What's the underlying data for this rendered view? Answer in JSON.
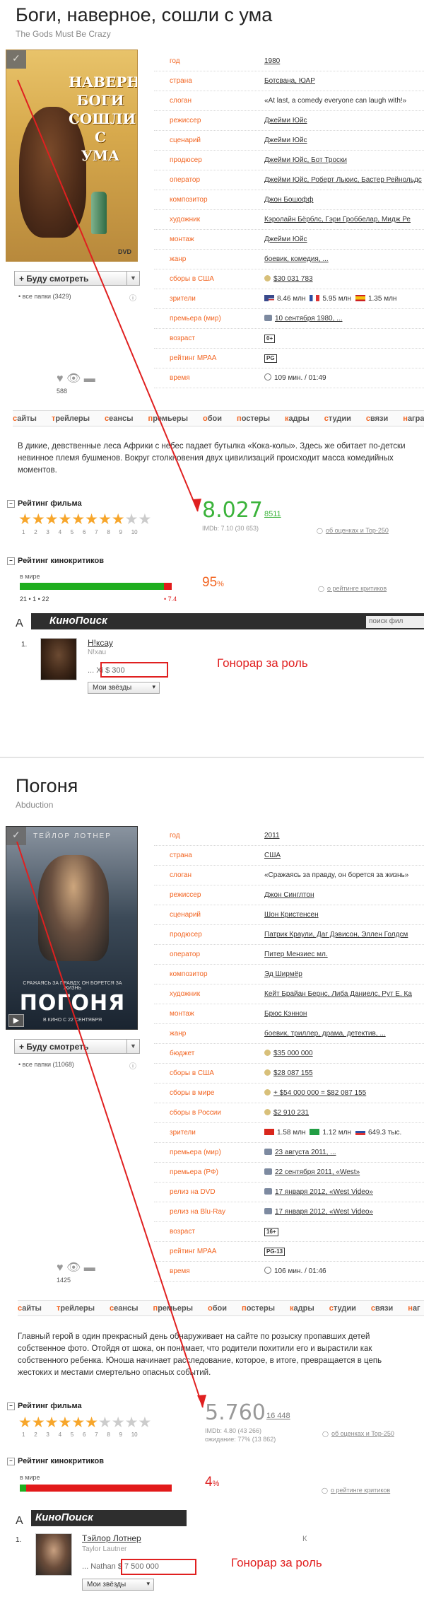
{
  "panel1": {
    "title": "Боги, наверное, сошли с ума",
    "orig_title": "The Gods Must Be Crazy",
    "poster_text": "НАВЕРНОЕ\nБОГИ\nСОШЛИ\nС\nУМА",
    "poster_dvd": "DVD",
    "will_watch": "Буду смотреть",
    "all_folders": "• все папки (3429)",
    "likes_count": "588",
    "info": [
      {
        "key": "год",
        "val": "1980",
        "link": true
      },
      {
        "key": "страна",
        "val": "Ботсвана, ЮАР",
        "link": true
      },
      {
        "key": "слоган",
        "val": "«At last, a comedy everyone can laugh with!»",
        "link": false
      },
      {
        "key": "режиссер",
        "val": "Джейми Юйс",
        "link": true
      },
      {
        "key": "сценарий",
        "val": "Джейми Юйс",
        "link": true
      },
      {
        "key": "продюсер",
        "val": "Джейми Юйс, Бот Троски",
        "link": true
      },
      {
        "key": "оператор",
        "val": "Джейми Юйс, Роберт Льюис, Бастер Рейнольдс",
        "link": true
      },
      {
        "key": "композитор",
        "val": "Джон Бошофф",
        "link": true
      },
      {
        "key": "художник",
        "val": "Кэролайн Бёрблс, Гэри Гроббелар, Мидж Ре",
        "link": true
      },
      {
        "key": "монтаж",
        "val": "Джейми Юйс",
        "link": true
      },
      {
        "key": "жанр",
        "val": "боевик, комедия, ...",
        "link": true
      },
      {
        "key": "сборы в США",
        "val": "$30 031 783",
        "link": true,
        "icon": "coin"
      },
      {
        "key": "зрители",
        "val": "",
        "link": false
      },
      {
        "key": "премьера (мир)",
        "val": "10 сентября 1980, ...",
        "link": true,
        "icon": "cal"
      },
      {
        "key": "возраст",
        "val": "0+",
        "link": false,
        "badge": true
      },
      {
        "key": "рейтинг MPAA",
        "val": "PG",
        "link": false,
        "badge": true
      },
      {
        "key": "время",
        "val": "109 мин. / 01:49",
        "link": false,
        "icon": "clock"
      }
    ],
    "viewers": [
      {
        "flag": "us",
        "val": "8.46 млн"
      },
      {
        "flag": "fr",
        "val": "5.95 млн"
      },
      {
        "flag": "es",
        "val": "1.35 млн"
      }
    ],
    "tabs": [
      "сайты",
      "трейлеры",
      "сеансы",
      "премьеры",
      "обои",
      "постеры",
      "кадры",
      "студии",
      "связи",
      "награды"
    ],
    "description": "В дикие, девственные леса Африки с небес падает бутылка «Кока-колы». Здесь же обитает по-детски невинное племя бушменов. Вокруг столкновения двух цивилизаций происходит масса комедийных моментов.",
    "rating_head": "Рейтинг фильма",
    "stars_on": 8,
    "stars_total": 10,
    "star_numbers": [
      "1",
      "2",
      "3",
      "4",
      "5",
      "6",
      "7",
      "8",
      "9",
      "10"
    ],
    "rating": "8.027",
    "votes": "8511",
    "imdb": "IMDb: 7.10 (30 653)",
    "about_link": "об оценках и Top-250",
    "critics_head": "Рейтинг кинокритиков",
    "critics_world": "в мире",
    "critics_counts": "21 • 1 • 22",
    "critics_score": "• 7.4",
    "critics_pct": "95",
    "critics_pct_sign": "%",
    "critics_fraction": 0.95,
    "critics_link": "о рейтинге критиков",
    "kp_logo": "КиноПоиск",
    "kp_search": "поиск фил",
    "kp_left": "А",
    "actor_num": "1.",
    "actor_name": "Н!ксау",
    "actor_orig": "N!xau",
    "actor_role": "... Xi",
    "fee": "$ 300",
    "my_stars": "Мои звёзды",
    "fee_label": "Гонорар за роль"
  },
  "panel2": {
    "title": "Погоня",
    "orig_title": "Abduction",
    "poster_actor": "ТЕЙЛОР ЛОТНЕР",
    "poster_tag": "СРАЖАЯСЬ ЗА ПРАВДУ, ОН БОРЕТСЯ ЗА ЖИЗНЬ",
    "poster_name": "ПОГОНЯ",
    "poster_date": "В КИНО С 22 СЕНТЯБРЯ",
    "will_watch": "Буду смотреть",
    "all_folders": "• все папки (11068)",
    "likes_count": "1425",
    "info": [
      {
        "key": "год",
        "val": "2011",
        "link": true
      },
      {
        "key": "страна",
        "val": "США",
        "link": true
      },
      {
        "key": "слоган",
        "val": "«Сражаясь за правду, он борется за жизнь»",
        "link": false
      },
      {
        "key": "режиссер",
        "val": "Джон Синглтон",
        "link": true
      },
      {
        "key": "сценарий",
        "val": "Шон Кристенсен",
        "link": true
      },
      {
        "key": "продюсер",
        "val": "Патрик Краули, Даг Дэвисон, Эллен Голдсм",
        "link": true
      },
      {
        "key": "оператор",
        "val": "Питер Мензиес мл.",
        "link": true
      },
      {
        "key": "композитор",
        "val": "Эд Ширмёр",
        "link": true
      },
      {
        "key": "художник",
        "val": "Кейт Брайан Бернс, Либа Даниелс, Рут Е. Ка",
        "link": true
      },
      {
        "key": "монтаж",
        "val": "Брюс Кэннон",
        "link": true
      },
      {
        "key": "жанр",
        "val": "боевик, триллер, драма, детектив, ...",
        "link": true
      },
      {
        "key": "бюджет",
        "val": "$35 000 000",
        "link": true,
        "icon": "coin"
      },
      {
        "key": "сборы в США",
        "val": "$28 087 155",
        "link": true,
        "icon": "coin"
      },
      {
        "key": "сборы в мире",
        "val": "+ $54 000 000 = $82 087 155",
        "link": true,
        "icon": "coin"
      },
      {
        "key": "сборы в России",
        "val": "$2 910 231",
        "link": true,
        "icon": "coin"
      },
      {
        "key": "зрители",
        "val": "",
        "link": false
      },
      {
        "key": "премьера (мир)",
        "val": "23 августа 2011, ...",
        "link": true,
        "icon": "cal"
      },
      {
        "key": "премьера (РФ)",
        "val": "22 сентября 2011, «West»",
        "link": true,
        "icon": "cal"
      },
      {
        "key": "релиз на DVD",
        "val": "17 января 2012, «West Video»",
        "link": true,
        "icon": "cal"
      },
      {
        "key": "релиз на Blu-Ray",
        "val": "17 января 2012, «West Video»",
        "link": true,
        "icon": "cal"
      },
      {
        "key": "возраст",
        "val": "16+",
        "link": false,
        "badge": true
      },
      {
        "key": "рейтинг MPAA",
        "val": "PG-13",
        "link": false,
        "badge": true
      },
      {
        "key": "время",
        "val": "106 мин. / 01:46",
        "link": false,
        "icon": "clock"
      }
    ],
    "viewers": [
      {
        "flag": "cn",
        "val": "1.58 млн"
      },
      {
        "flag": "br",
        "val": "1.12 млн"
      },
      {
        "flag": "ru",
        "val": "649.3 тыс."
      }
    ],
    "tabs": [
      "сайты",
      "трейлеры",
      "сеансы",
      "премьеры",
      "обои",
      "постеры",
      "кадры",
      "студии",
      "связи",
      "наг"
    ],
    "description": "Главный герой в один прекрасный день обнаруживает на сайте по розыску пропавших детей собственное фото. Отойдя от шока, он понимает, что родители похитили его и вырастили как собственного ребенка. Юноша начинает расследование, которое, в итоге, превращается в цепь жестоких и местами смертельно опасных событий.",
    "rating_head": "Рейтинг фильма",
    "stars_on": 6,
    "stars_total": 10,
    "star_numbers": [
      "1",
      "2",
      "3",
      "4",
      "5",
      "6",
      "7",
      "8",
      "9",
      "10"
    ],
    "rating": "5.760",
    "votes": "16 448",
    "imdb": "IMDb: 4.80 (43 266)",
    "expect": "ожидание: 77% (13 862)",
    "about_link": "об оценках и Top-250",
    "critics_head": "Рейтинг кинокритиков",
    "critics_world": "в мире",
    "critics_pct": "4",
    "critics_pct_sign": "%",
    "critics_fraction": 0.04,
    "critics_link": "о рейтинге критиков",
    "kp_logo": "КиноПоиск",
    "kp_left": "А",
    "actor_num": "1.",
    "actor_name": "Тэйлор Лотнер",
    "actor_orig": "Taylor Lautner",
    "actor_role": "... Nathan",
    "fee": "$ 7 500 000",
    "my_stars": "Мои звёзды",
    "fee_label": "Гонорар за роль",
    "edge_k": "К"
  },
  "colors": {
    "accent": "#f26522",
    "green": "#3bb33b",
    "red": "#e02020",
    "star": "#f7a62b"
  }
}
